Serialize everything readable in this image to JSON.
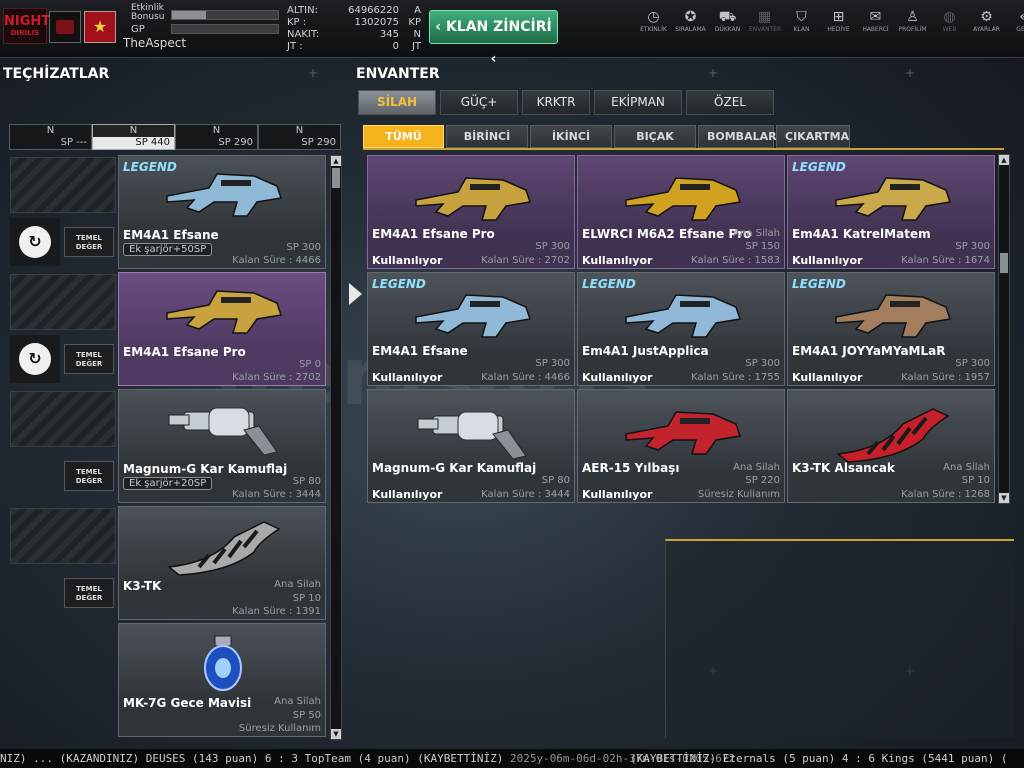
{
  "top": {
    "logo_text": "NIGHT",
    "logo_sub": "DIRILIS",
    "bonus_label_1": "Etkinlik",
    "bonus_label_2": "Bonusu",
    "bonus_progress": 0.32,
    "gp_label": "GP",
    "player_name": "TheAspect",
    "currency": [
      {
        "label": "ALTIN:",
        "value": "64966220",
        "unit": "A"
      },
      {
        "label": "KP :",
        "value": "1302075",
        "unit": "KP"
      },
      {
        "label": "NAKIT:",
        "value": "345",
        "unit": "N"
      },
      {
        "label": "JT :",
        "value": "0",
        "unit": "JT"
      }
    ],
    "klan_button": "KLAN ZİNCİRİ",
    "nav": [
      {
        "label": "ETKİNLİK",
        "icon": "◷",
        "name": "event-icon"
      },
      {
        "label": "SIRALAMA",
        "icon": "✪",
        "name": "ranking-icon"
      },
      {
        "label": "DÜKKAN",
        "icon": "⛟",
        "name": "shop-icon"
      },
      {
        "label": "ENVANTER",
        "icon": "▦",
        "name": "inventory-icon",
        "dim": true
      },
      {
        "label": "KLAN",
        "icon": "⛉",
        "name": "clan-icon"
      },
      {
        "label": "HEDİYE",
        "icon": "⊞",
        "name": "gift-icon"
      },
      {
        "label": "HABERCİ",
        "icon": "✉",
        "name": "messenger-icon"
      },
      {
        "label": "PROFİLİM",
        "icon": "♙",
        "name": "profile-icon"
      },
      {
        "label": "WEB",
        "icon": "◍",
        "name": "web-icon",
        "dim": true
      },
      {
        "label": "AYARLAR",
        "icon": "⚙",
        "name": "settings-icon"
      },
      {
        "label": "GERİ",
        "icon": "«",
        "name": "back-icon"
      }
    ]
  },
  "left": {
    "title": "TEÇHİZATLAR",
    "slot_tabs": [
      {
        "n": "N",
        "sp": "SP ---"
      },
      {
        "n": "N",
        "sp": "SP 440",
        "active": true
      },
      {
        "n": "N",
        "sp": "SP 290"
      },
      {
        "n": "N",
        "sp": "SP 290"
      }
    ],
    "temel_label": "TEMEL DEĞER",
    "items": [
      {
        "name": "EM4A1 Efsane",
        "sub": "Ek şarjör+50SP",
        "r1": "",
        "r2": "SP 300",
        "r3": "Kalan Süre : 4466",
        "legend": true,
        "reload": true,
        "selected": false
      },
      {
        "name": "EM4A1 Efsane Pro",
        "sub": "",
        "r1": "",
        "r2": "SP 0",
        "r3": "Kalan Süre : 2702",
        "legend": false,
        "reload": true,
        "selected": true
      },
      {
        "name": "Magnum-G Kar Kamuflaj",
        "sub": "Ek şarjör+20SP",
        "r1": "",
        "r2": "SP 80",
        "r3": "Kalan Süre : 3444",
        "legend": false,
        "reload": false,
        "selected": false
      },
      {
        "name": "K3-TK",
        "sub": "",
        "r1": "Ana Silah",
        "r2": "SP 10",
        "r3": "Kalan Süre : 1391",
        "legend": false,
        "reload": false,
        "selected": false
      },
      {
        "name": "MK-7G Gece Mavisi",
        "sub": "",
        "r1": "Ana Silah",
        "r2": "SP 50",
        "r3": "Süresiz Kullanım",
        "legend": false,
        "reload": false,
        "selected": false
      }
    ]
  },
  "right": {
    "title": "ENVANTER",
    "main_tabs": [
      "SİLAH",
      "GÜÇ+",
      "KRKTR",
      "EKİPMAN",
      "ÖZEL"
    ],
    "sub_tabs": [
      "TÜMÜ",
      "BİRİNCİ",
      "İKİNCİ",
      "BIÇAK",
      "BOMBALAR",
      "ÇIKARTMA"
    ],
    "items": [
      {
        "name": "EM4A1 Efsane Pro",
        "r1": "",
        "r2": "SP 300",
        "status": "Kullanılıyor",
        "r3": "Kalan Süre : 2702",
        "purple": true,
        "legend": false
      },
      {
        "name": "ELWRCI M6A2 Efsane Pro",
        "r1": "Ana Silah",
        "r2": "SP 150",
        "status": "Kullanılıyor",
        "r3": "Kalan Süre : 1583",
        "purple": true,
        "legend": false
      },
      {
        "name": "Em4A1 KatrelMatem",
        "r1": "",
        "r2": "SP 300",
        "status": "Kullanılıyor",
        "r3": "Kalan Süre : 1674",
        "purple": true,
        "legend": true
      },
      {
        "name": "EM4A1 Efsane",
        "r1": "",
        "r2": "SP 300",
        "status": "Kullanılıyor",
        "r3": "Kalan Süre : 4466",
        "purple": false,
        "legend": true
      },
      {
        "name": "Em4A1 JustApplica",
        "r1": "",
        "r2": "SP 300",
        "status": "Kullanılıyor",
        "r3": "Kalan Süre : 1755",
        "purple": false,
        "legend": true
      },
      {
        "name": "EM4A1 JOYYaMYaMLaR",
        "r1": "",
        "r2": "SP 300",
        "status": "Kullanılıyor",
        "r3": "Kalan Süre : 1957",
        "purple": false,
        "legend": true
      },
      {
        "name": "Magnum-G Kar Kamuflaj",
        "r1": "",
        "r2": "SP 80",
        "status": "Kullanılıyor",
        "r3": "Kalan Süre : 3444",
        "purple": false,
        "legend": false
      },
      {
        "name": "AER-15 Yılbaşı",
        "r1": "Ana Silah",
        "r2": "SP 220",
        "status": "Kullanılıyor",
        "r3": "Süresiz Kullanım",
        "purple": false,
        "legend": false
      },
      {
        "name": "K3-TK Alsancak",
        "r1": "Ana Silah",
        "r2": "SP 10",
        "status": "",
        "r3": "Kalan Süre : 1268",
        "purple": false,
        "legend": false
      }
    ]
  },
  "legend_text": "LEGEND",
  "watermark": "itemsatis",
  "ticker_left": "NIZ) ... (KAZANDINIZ) DEUSES (143 puan) 6 : 3 TopTeam (4 puan) (KAYBETTİNİZ)",
  "ticker_date": "2025y-06m-06d-02h-37m-01s-0205-672",
  "ticker_right": "(KAYBETTİNİZ) Eternals (5 puan) 4 : 6 Kings (5441 puan) (",
  "colors": {
    "accent": "#f4b21b",
    "selected_purple": "#5f4773",
    "klan_green": "#2f8c60"
  }
}
